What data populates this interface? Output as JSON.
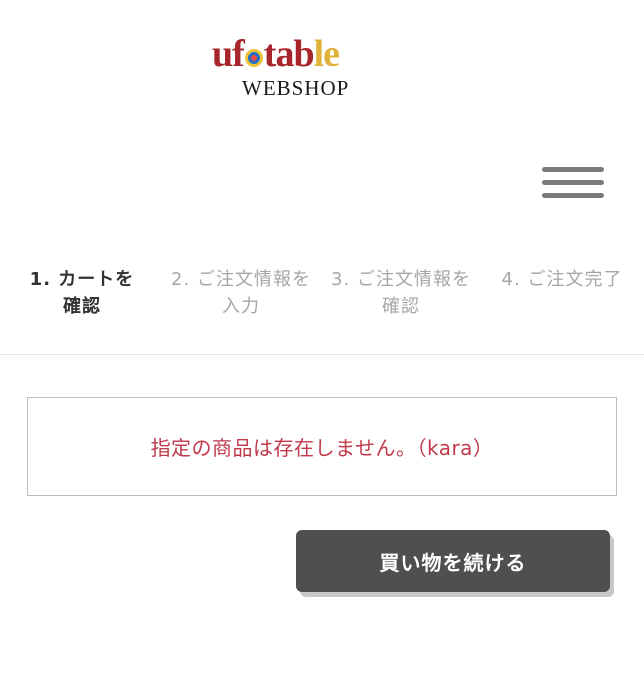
{
  "header": {
    "logo_wordmark": "ufotable",
    "logo_subtitle": "WEBSHOP"
  },
  "menu": {
    "icon": "hamburger-menu-icon"
  },
  "steps": [
    {
      "line1": "1. カートを",
      "line2": "確認",
      "active": true
    },
    {
      "line1": "2. ご注文情報を",
      "line2": "入力",
      "active": false
    },
    {
      "line1": "3. ご注文情報を",
      "line2": "確認",
      "active": false
    },
    {
      "line1": "4. ご注文完了",
      "line2": "",
      "active": false
    }
  ],
  "alert": {
    "message": "指定の商品は存在しません。（kara）",
    "color": "#c1394a"
  },
  "actions": {
    "continue_label": "買い物を続ける"
  }
}
